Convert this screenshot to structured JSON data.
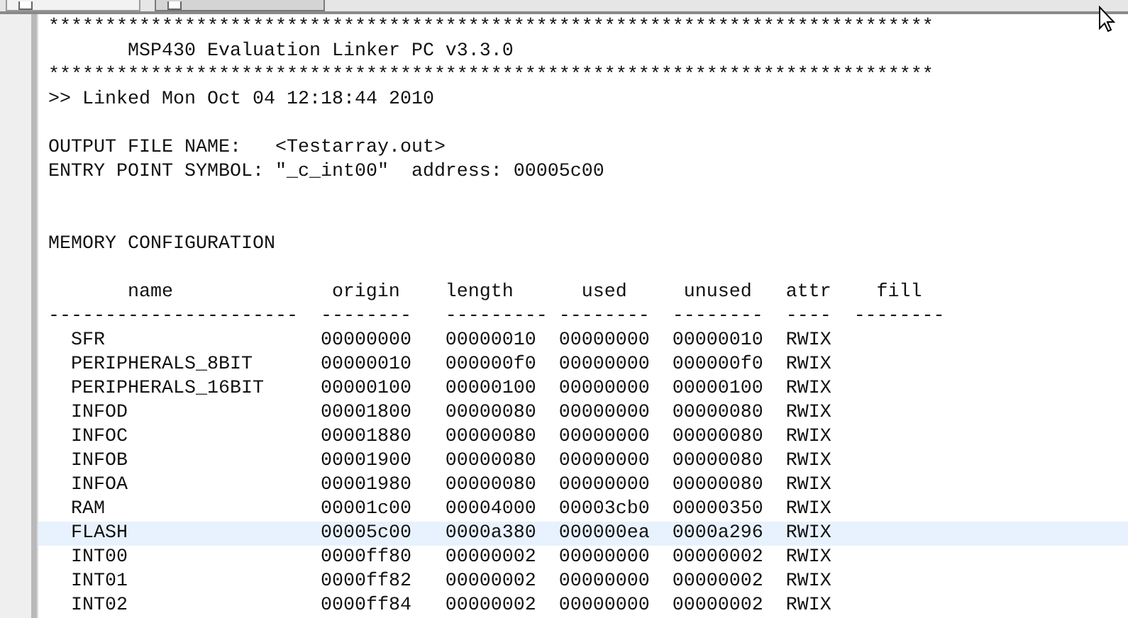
{
  "tabs": [
    {
      "selected": false
    },
    {
      "selected": true
    }
  ],
  "lines": [
    {
      "kind": "text",
      "text": "******************************************************************************"
    },
    {
      "kind": "text",
      "text": "       MSP430 Evaluation Linker PC v3.3.0"
    },
    {
      "kind": "text",
      "text": "******************************************************************************"
    },
    {
      "kind": "text",
      "text": ">> Linked Mon Oct 04 12:18:44 2010"
    },
    {
      "kind": "blank"
    },
    {
      "kind": "text",
      "text": "OUTPUT FILE NAME:   <Testarray.out>"
    },
    {
      "kind": "text",
      "text": "ENTRY POINT SYMBOL: \"_c_int00\"  address: 00005c00"
    },
    {
      "kind": "blank"
    },
    {
      "kind": "blank"
    },
    {
      "kind": "text",
      "text": "MEMORY CONFIGURATION"
    },
    {
      "kind": "blank"
    }
  ],
  "table": {
    "columns": [
      "name",
      "origin",
      "length",
      "used",
      "unused",
      "attr",
      "fill"
    ],
    "separators": [
      "----------------------",
      "--------",
      "---------",
      "--------",
      "--------",
      "----",
      "--------"
    ],
    "rows": [
      {
        "selected": false,
        "cells": [
          "SFR",
          "00000000",
          "00000010",
          "00000000",
          "00000010",
          "RWIX"
        ]
      },
      {
        "selected": false,
        "cells": [
          "PERIPHERALS_8BIT",
          "00000010",
          "000000f0",
          "00000000",
          "000000f0",
          "RWIX"
        ]
      },
      {
        "selected": false,
        "cells": [
          "PERIPHERALS_16BIT",
          "00000100",
          "00000100",
          "00000000",
          "00000100",
          "RWIX"
        ]
      },
      {
        "selected": false,
        "cells": [
          "INFOD",
          "00001800",
          "00000080",
          "00000000",
          "00000080",
          "RWIX"
        ]
      },
      {
        "selected": false,
        "cells": [
          "INFOC",
          "00001880",
          "00000080",
          "00000000",
          "00000080",
          "RWIX"
        ]
      },
      {
        "selected": false,
        "cells": [
          "INFOB",
          "00001900",
          "00000080",
          "00000000",
          "00000080",
          "RWIX"
        ]
      },
      {
        "selected": false,
        "cells": [
          "INFOA",
          "00001980",
          "00000080",
          "00000000",
          "00000080",
          "RWIX"
        ]
      },
      {
        "selected": false,
        "cells": [
          "RAM",
          "00001c00",
          "00004000",
          "00003cb0",
          "00000350",
          "RWIX"
        ]
      },
      {
        "selected": true,
        "cells": [
          "FLASH",
          "00005c00",
          "0000a380",
          "000000ea",
          "0000a296",
          "RWIX"
        ]
      },
      {
        "selected": false,
        "cells": [
          "INT00",
          "0000ff80",
          "00000002",
          "00000000",
          "00000002",
          "RWIX"
        ]
      },
      {
        "selected": false,
        "cells": [
          "INT01",
          "0000ff82",
          "00000002",
          "00000000",
          "00000002",
          "RWIX"
        ]
      },
      {
        "selected": false,
        "cells": [
          "INT02",
          "0000ff84",
          "00000002",
          "00000000",
          "00000002",
          "RWIX"
        ]
      }
    ]
  }
}
